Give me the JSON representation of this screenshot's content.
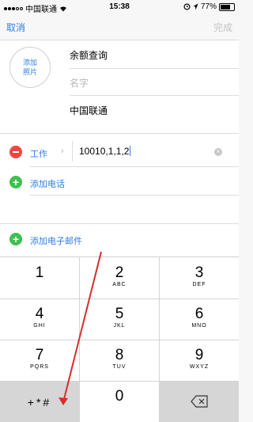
{
  "status": {
    "carrier": "中国联通",
    "time": "15:38",
    "battery": "77%"
  },
  "nav": {
    "cancel": "取消",
    "done": "完成"
  },
  "contact": {
    "add_photo": "添加照片",
    "company": "余额查询",
    "name_placeholder": "名字",
    "carrier": "中国联通"
  },
  "phone": {
    "label": "工作",
    "value": "10010,1,1,2"
  },
  "add_phone": "添加电话",
  "add_email": "添加电子邮件",
  "keypad": [
    {
      "digit": "1",
      "letters": ""
    },
    {
      "digit": "2",
      "letters": "ABC"
    },
    {
      "digit": "3",
      "letters": "DEF"
    },
    {
      "digit": "4",
      "letters": "GHI"
    },
    {
      "digit": "5",
      "letters": "JKL"
    },
    {
      "digit": "6",
      "letters": "MNO"
    },
    {
      "digit": "7",
      "letters": "PQRS"
    },
    {
      "digit": "8",
      "letters": "TUV"
    },
    {
      "digit": "9",
      "letters": "WXYZ"
    }
  ],
  "symbols_key": "+*#",
  "zero_key": "0",
  "accent_color": "#2f7ee5"
}
